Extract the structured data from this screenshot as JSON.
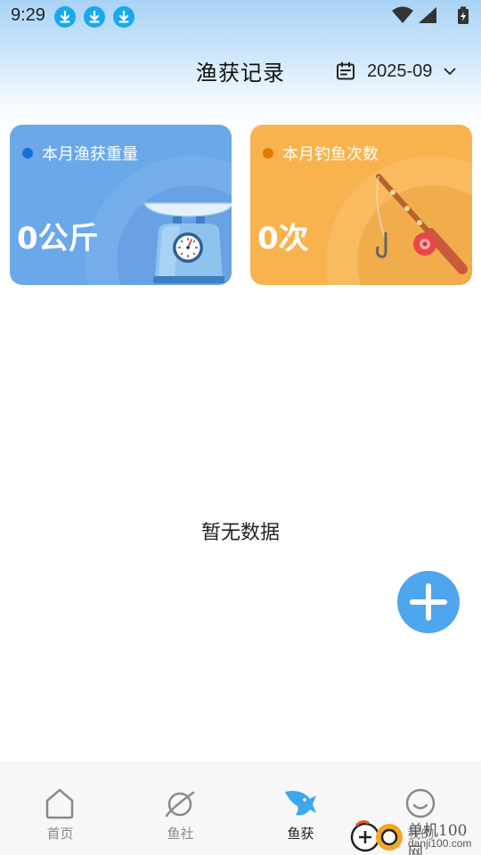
{
  "status_bar": {
    "time": "9:29",
    "notification_icons": [
      "download-icon",
      "download-icon",
      "download-icon"
    ],
    "system_icons": [
      "wifi-icon",
      "signal-icon",
      "battery-charging-icon"
    ]
  },
  "header": {
    "title": "渔获记录",
    "date_icon": "calendar-icon",
    "date_value": "2025-09",
    "dropdown_icon": "chevron-down-icon"
  },
  "stats": {
    "weight": {
      "label": "本月渔获重量",
      "value": "0公斤",
      "color": "#6ba8ea",
      "image": "scale-image"
    },
    "trips": {
      "label": "本月钓鱼次数",
      "value": "0次",
      "color": "#f9b34e",
      "image": "fishing-rod-image"
    }
  },
  "empty_state": {
    "text": "暂无数据"
  },
  "fab": {
    "icon": "plus-icon",
    "color": "#4da6ee"
  },
  "tabbar": {
    "tabs": [
      {
        "label": "首页",
        "icon": "home-icon"
      },
      {
        "label": "鱼社",
        "icon": "planet-icon"
      },
      {
        "label": "鱼获",
        "icon": "fish-icon",
        "active": true
      },
      {
        "label": "我的",
        "icon": "smile-icon"
      }
    ]
  },
  "watermark": {
    "name": "单机100网",
    "url": "danji100.com"
  }
}
